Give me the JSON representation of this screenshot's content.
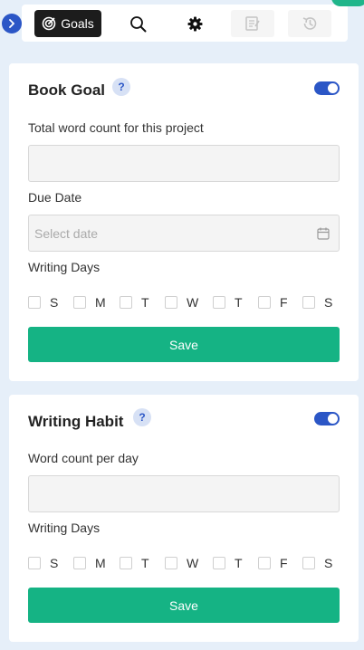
{
  "toolbar": {
    "goals_label": "Goals"
  },
  "book_goal": {
    "title": "Book Goal",
    "help": "?",
    "toggle_on": true,
    "word_count_label": "Total word count for this project",
    "word_count_value": "",
    "due_date_label": "Due Date",
    "due_date_placeholder": "Select date",
    "writing_days_label": "Writing Days",
    "days": [
      "S",
      "M",
      "T",
      "W",
      "T",
      "F",
      "S"
    ],
    "save_label": "Save"
  },
  "writing_habit": {
    "title": "Writing Habit",
    "help": "?",
    "toggle_on": true,
    "word_count_label": "Word count per day",
    "word_count_value": "",
    "writing_days_label": "Writing Days",
    "days": [
      "S",
      "M",
      "T",
      "W",
      "T",
      "F",
      "S"
    ],
    "save_label": "Save"
  },
  "colors": {
    "accent": "#2b56c6",
    "save": "#15b384",
    "page_bg": "#e6eff9"
  },
  "icons": [
    "chevron-right-icon",
    "target-icon",
    "search-icon",
    "gear-icon",
    "notes-icon",
    "history-icon",
    "calendar-icon"
  ]
}
